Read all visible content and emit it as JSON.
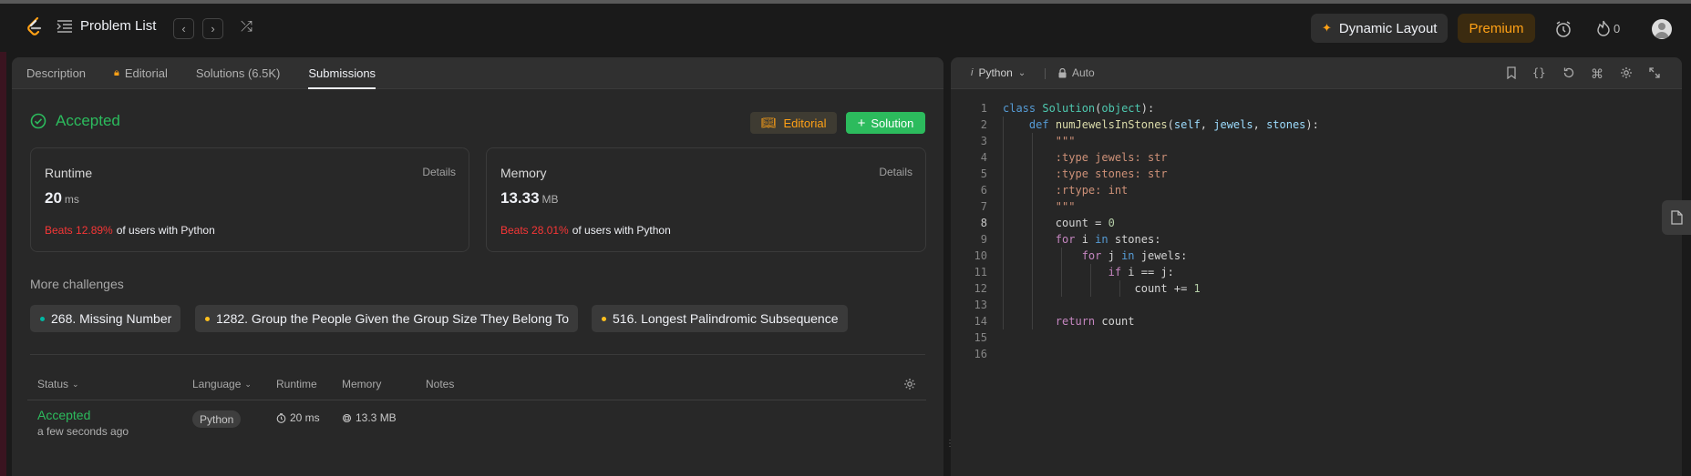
{
  "header": {
    "problem_list": "Problem List",
    "dynamic_layout": "Dynamic Layout",
    "premium": "Premium",
    "streak_count": "0"
  },
  "tabs": [
    "Description",
    "Editorial",
    "Solutions (6.5K)",
    "Submissions"
  ],
  "result": {
    "status": "Accepted",
    "editorial_btn": "Editorial",
    "solution_btn": "Solution"
  },
  "runtime": {
    "title": "Runtime",
    "details": "Details",
    "value": "20",
    "unit": "ms",
    "beats": "Beats 12.89%",
    "beats_suffix": "of users with Python"
  },
  "memory": {
    "title": "Memory",
    "details": "Details",
    "value": "13.33",
    "unit": "MB",
    "beats": "Beats 28.01%",
    "beats_suffix": "of users with Python"
  },
  "more_challenges": {
    "label": "More challenges",
    "items": [
      {
        "text": "268. Missing Number",
        "color": "#00b8a3"
      },
      {
        "text": "1282. Group the People Given the Group Size They Belong To",
        "color": "#ffc01e"
      },
      {
        "text": "516. Longest Palindromic Subsequence",
        "color": "#ffc01e"
      }
    ]
  },
  "table": {
    "headers": [
      "Status",
      "Language",
      "Runtime",
      "Memory",
      "Notes"
    ],
    "row": {
      "status": "Accepted",
      "time": "a few seconds ago",
      "language": "Python",
      "runtime": "20 ms",
      "memory": "13.3 MB"
    }
  },
  "editor": {
    "language": "Python",
    "mode": "Auto",
    "line_numbers": [
      "1",
      "2",
      "3",
      "4",
      "5",
      "6",
      "7",
      "8",
      "9",
      "10",
      "11",
      "12",
      "13",
      "14",
      "15",
      "16"
    ]
  },
  "colors": {
    "accent": "#ffa116",
    "accepted": "#2cbb5d",
    "beats": "#f63636"
  }
}
